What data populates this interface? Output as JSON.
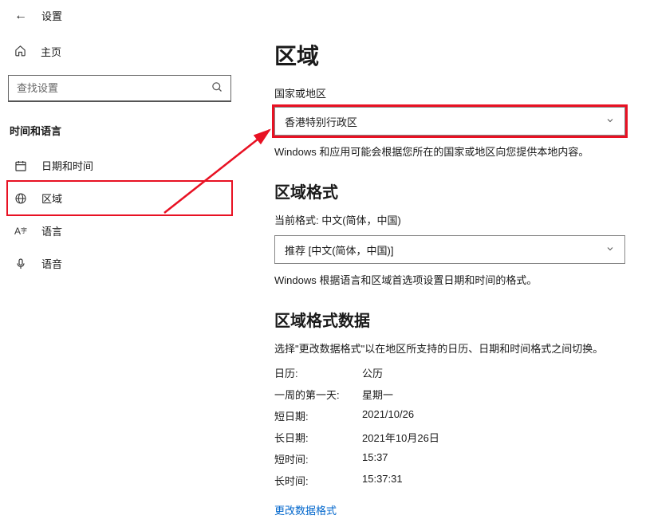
{
  "window": {
    "title": "设置"
  },
  "sidebar": {
    "home_label": "主页",
    "search_placeholder": "查找设置",
    "category_label": "时间和语言",
    "items": [
      {
        "label": "日期和时间"
      },
      {
        "label": "区域"
      },
      {
        "label": "语言"
      },
      {
        "label": "语音"
      }
    ]
  },
  "content": {
    "page_title": "区域",
    "country_label": "国家或地区",
    "country_value": "香港特别行政区",
    "country_hint": "Windows 和应用可能会根据您所在的国家或地区向您提供本地内容。",
    "region_format_heading": "区域格式",
    "current_format_label": "当前格式: 中文(简体，中国)",
    "region_format_value": "推荐 [中文(简体，中国)]",
    "region_format_hint": "Windows 根据语言和区域首选项设置日期和时间的格式。",
    "data_heading": "区域格式数据",
    "data_desc": "选择\"更改数据格式\"以在地区所支持的日历、日期和时间格式之间切换。",
    "rows": [
      {
        "k": "日历:",
        "v": "公历"
      },
      {
        "k": "一周的第一天:",
        "v": "星期一"
      },
      {
        "k": "短日期:",
        "v": "2021/10/26"
      },
      {
        "k": "长日期:",
        "v": "2021年10月26日"
      },
      {
        "k": "短时间:",
        "v": "15:37"
      },
      {
        "k": "长时间:",
        "v": "15:37:31"
      }
    ],
    "change_link": "更改数据格式"
  }
}
